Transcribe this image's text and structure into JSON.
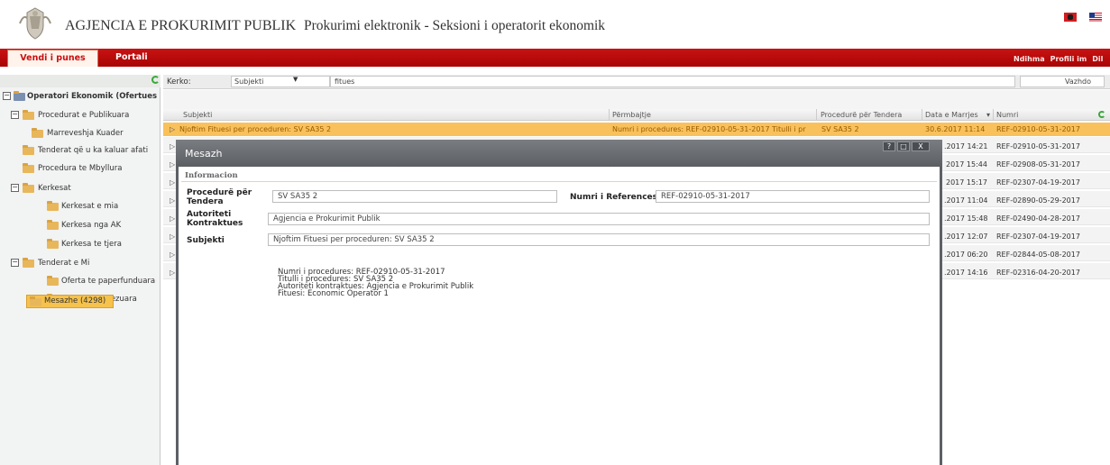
{
  "header": {
    "agency_title": "AGJENCIA E PROKURIMIT PUBLIK",
    "portal_title": "Prokurimi elektronik - Seksioni i operatorit ekonomik",
    "logo": "coat-of-arms"
  },
  "menu": {
    "tab_vendi": "Vendi i punes",
    "tab_portali": "Portali",
    "ndihma": "Ndihma",
    "profili": "Profili im",
    "dil": "Dil"
  },
  "sidebar": {
    "root": "Operatori Ekonomik (Ofertues",
    "items": [
      {
        "label": "Procedurat e Publikuara"
      },
      {
        "label": "Marreveshja Kuader"
      },
      {
        "label": "Tenderat që u ka kaluar afati"
      },
      {
        "label": "Procedura te Mbyllura"
      },
      {
        "label": "Kerkesat"
      },
      {
        "label": "Kerkesat e mia"
      },
      {
        "label": "Kerkesa nga AK"
      },
      {
        "label": "Kerkesa te tjera"
      },
      {
        "label": "Tenderat e Mi"
      },
      {
        "label": "Oferta te paperfunduara"
      },
      {
        "label": "Oferta te dorezuara"
      },
      {
        "label": "Mesazhe (4298)"
      }
    ]
  },
  "search": {
    "label": "Kerko:",
    "field_value": "Subjekti",
    "input_value": "fitues",
    "button": "Vazhdo"
  },
  "grid": {
    "columns": [
      "Subjekti",
      "Përmbajtje",
      "Procedurë për Tendera",
      "Data e Marrjes",
      "Numri"
    ],
    "sort_indicator": "▾",
    "selected_row": {
      "subjekti": "Njoftim Fituesi per proceduren: SV SA35 2",
      "permbajtje": "Numri i procedures: REF-02910-05-31-2017 Titulli i pr",
      "procedure": "SV SA35 2",
      "data": "30.6.2017 11:14",
      "numri": "REF-02910-05-31-2017"
    },
    "rows": [
      {
        "data": ".2017 14:21",
        "numri": "REF-02910-05-31-2017"
      },
      {
        "data": "2017 15:44",
        "numri": "REF-02908-05-31-2017"
      },
      {
        "data": "2017 15:17",
        "numri": "REF-02307-04-19-2017"
      },
      {
        "data": ".2017 11:04",
        "numri": "REF-02890-05-29-2017"
      },
      {
        "data": ".2017 15:48",
        "numri": "REF-02490-04-28-2017"
      },
      {
        "data": ".2017 12:07",
        "numri": "REF-02307-04-19-2017"
      },
      {
        "data": ".2017 06:20",
        "numri": "REF-02844-05-08-2017"
      },
      {
        "data": ".2017 14:16",
        "numri": "REF-02316-04-20-2017"
      }
    ]
  },
  "modal": {
    "title": "Mesazh",
    "section_title": "Informacion",
    "procedure_label": "Procedurë për Tendera",
    "procedure_value": "SV SA35 2",
    "reference_label": "Numri i References",
    "reference_value": "REF-02910-05-31-2017",
    "authority_label": "Autoriteti Kontraktues",
    "authority_value": "Agjencia e Prokurimit Publik",
    "subject_label": "Subjekti",
    "subject_value": "Njoftim Fituesi per proceduren: SV SA35 2",
    "message_lines": [
      "Numri i procedures: REF-02910-05-31-2017",
      "Titulli i procedures: SV SA35 2",
      "Autoriteti kontraktues: Agjencia e Prokurimit Publik",
      "Fituesi: Economic Operator 1"
    ],
    "buttons": [
      "?",
      "□",
      "X"
    ]
  }
}
